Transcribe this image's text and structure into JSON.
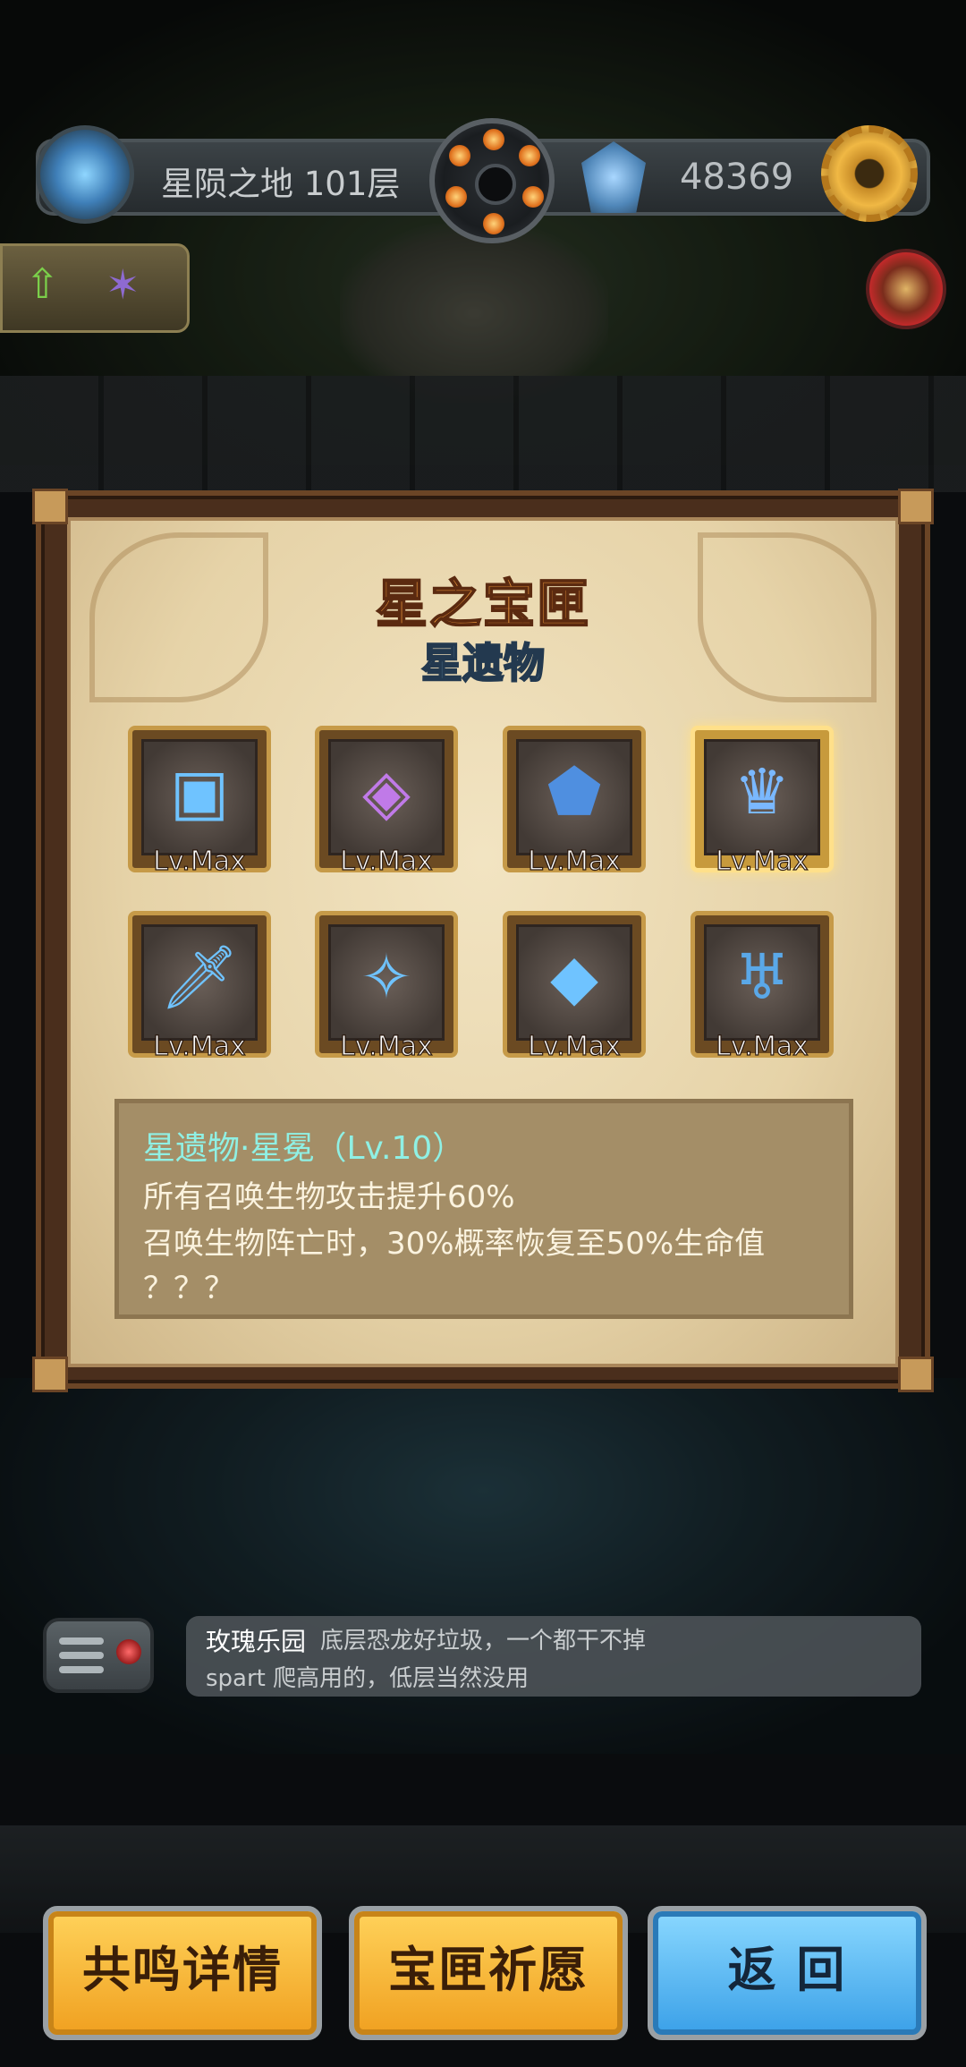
{
  "header": {
    "floor_label": "星陨之地 101层",
    "currency_value": "48369"
  },
  "panel": {
    "title": "星之宝匣",
    "subtitle": "星遗物",
    "relics": [
      {
        "name": "relic-slot-chest",
        "icon": "ornate-chest-icon",
        "level": "Lv.Max",
        "selected": false
      },
      {
        "name": "relic-slot-necklace",
        "icon": "gem-necklace-icon",
        "level": "Lv.Max",
        "selected": false
      },
      {
        "name": "relic-slot-shield",
        "icon": "crystal-shield-icon",
        "level": "Lv.Max",
        "selected": false
      },
      {
        "name": "relic-slot-crown",
        "icon": "crystal-crown-icon",
        "level": "Lv.Max",
        "selected": true
      },
      {
        "name": "relic-slot-dagger",
        "icon": "crystal-dagger-icon",
        "level": "Lv.Max",
        "selected": false
      },
      {
        "name": "relic-slot-staff",
        "icon": "crystal-staff-icon",
        "level": "Lv.Max",
        "selected": false
      },
      {
        "name": "relic-slot-shard",
        "icon": "crystal-shard-icon",
        "level": "Lv.Max",
        "selected": false
      },
      {
        "name": "relic-slot-goblet",
        "icon": "crystal-goblet-icon",
        "level": "Lv.Max",
        "selected": false
      }
    ],
    "description": {
      "title": "星遗物·星冕（Lv.10）",
      "lines": [
        "所有召唤生物攻击提升60%",
        "召唤生物阵亡时，30%概率恢复至50%生命值",
        "？？？"
      ]
    }
  },
  "chat": {
    "user": "玫瑰乐园",
    "message_1": "底层恐龙好垃圾，一个都干不掉",
    "message_2": "spart  爬高用的，低层当然没用"
  },
  "buttons": {
    "resonance": "共鸣详情",
    "wish": "宝匣祈愿",
    "back": "返 回"
  },
  "colors": {
    "title": "#f09a3c",
    "subtitle": "#9fd7ff",
    "desc_title": "#8ff0e4",
    "gold_button": "#f0a020",
    "blue_button": "#3aa0e8"
  }
}
